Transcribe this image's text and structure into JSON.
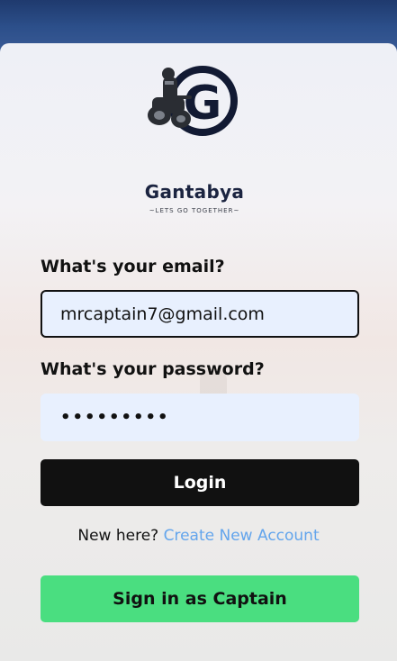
{
  "brand": {
    "name": "Gantabya",
    "tagline": "~LETS GO TOGETHER~",
    "logo_letter": "G"
  },
  "email": {
    "label": "What's your email?",
    "value": "mrcaptain7@gmail.com"
  },
  "password": {
    "label": "What's your password?",
    "value": "•••••••••"
  },
  "login_button": "Login",
  "signup": {
    "prompt": "New here?",
    "link": "Create New Account"
  },
  "captain_button": "Sign in as Captain",
  "colors": {
    "header_bg": "#2c4f8a",
    "login_bg": "#111111",
    "captain_bg": "#4ade80",
    "link": "#63a5ec",
    "input_bg": "#e8f0fe"
  }
}
